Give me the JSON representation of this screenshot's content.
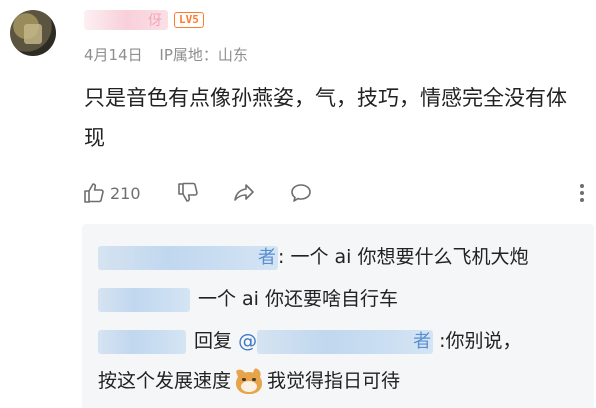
{
  "user": {
    "name_tail": "伢",
    "level": "LV5"
  },
  "meta": {
    "date": "4月14日",
    "ip_label": "IP属地：山东"
  },
  "comment": {
    "text": "只是音色有点像孙燕姿，气，技巧，情感完全没有体现"
  },
  "actions": {
    "like_count": "210",
    "icons": [
      "thumbs-up-icon",
      "thumbs-down-icon",
      "share-icon",
      "comment-icon",
      "more-icon"
    ]
  },
  "replies": [
    {
      "name_tail": "者",
      "text": ": 一个 ai 你想要什么飞机大炮"
    },
    {
      "text": "一个 ai 你还要啥自行车"
    },
    {
      "reply_word": "回复",
      "at": "@",
      "target_tail": "者",
      "text": " :你别说，",
      "name_tail": ""
    },
    {
      "text_before": "按这个发展速度",
      "emoji": "doge-emoji",
      "text_after": "我觉得指日可待"
    }
  ],
  "colors": {
    "level_badge": "#ff7a2e",
    "mention": "#3c78c8",
    "reply_bg": "#f5f6f8",
    "meta_text": "#8e8e8e"
  }
}
